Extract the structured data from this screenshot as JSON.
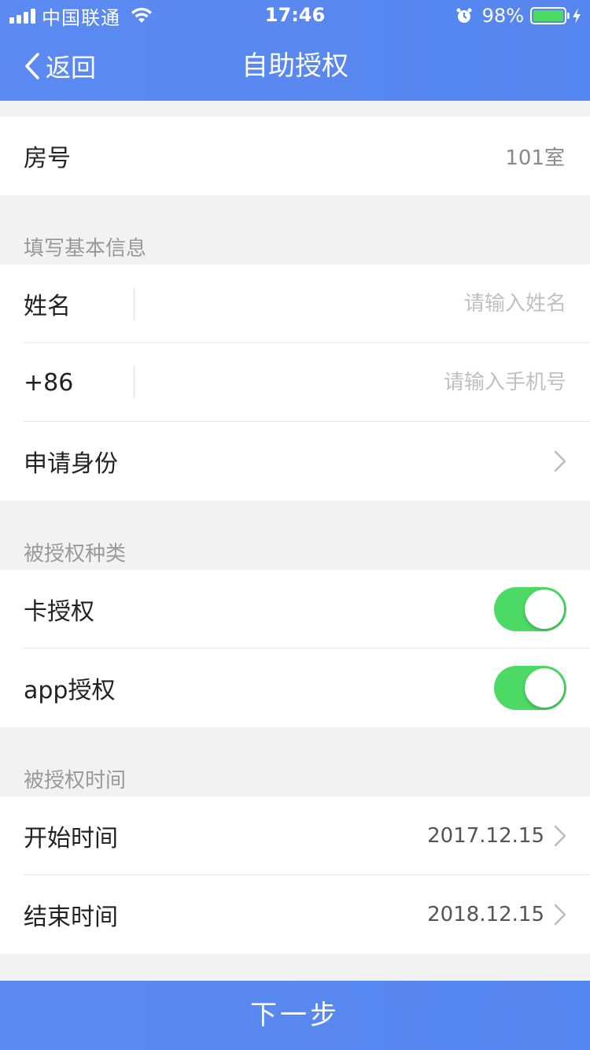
{
  "status_bar": {
    "carrier": "中国联通",
    "time": "17:46",
    "battery": "98%",
    "battery_color": "#4cd964"
  },
  "nav": {
    "back_label": "返回",
    "title": "自助授权",
    "bg_color": "#5585ee"
  },
  "room": {
    "label": "房号",
    "value": "101室"
  },
  "basic_info": {
    "section_title": "填写基本信息",
    "name": {
      "label": "姓名",
      "placeholder": "请输入姓名",
      "value": ""
    },
    "phone": {
      "label": "+86",
      "placeholder": "请输入手机号",
      "value": ""
    },
    "identity": {
      "label": "申请身份"
    }
  },
  "auth_type": {
    "section_title": "被授权种类",
    "card_auth": {
      "label": "卡授权",
      "enabled": true
    },
    "app_auth": {
      "label": "app授权",
      "enabled": true
    }
  },
  "auth_time": {
    "section_title": "被授权时间",
    "start": {
      "label": "开始时间",
      "value": "2017.12.15"
    },
    "end": {
      "label": "结束时间",
      "value": "2018.12.15"
    }
  },
  "footer": {
    "next_label": "下一步"
  },
  "icons": {
    "back": "chevron-left-icon",
    "row_arrow": "chevron-right-icon",
    "wifi": "wifi-icon",
    "alarm": "alarm-clock-icon",
    "charging": "lightning-bolt-icon"
  }
}
